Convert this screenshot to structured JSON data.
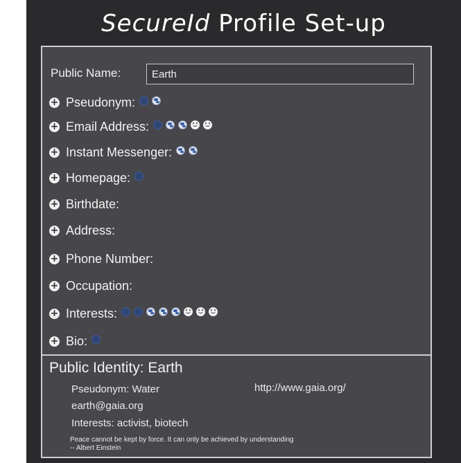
{
  "title": {
    "italic_part": "SecureId",
    "rest": " Profile Set-up"
  },
  "public_name": {
    "label": "Public Name:",
    "value": "Earth"
  },
  "fields": [
    {
      "label": "Pseudonym:",
      "icons": [
        "globe-icon",
        "earth-icon"
      ]
    },
    {
      "label": "Email Address:",
      "icons": [
        "globe-icon",
        "earth-icon",
        "earth-icon",
        "smiley-icon",
        "smiley-icon"
      ]
    },
    {
      "label": "Instant Messenger:",
      "icons": [
        "earth-icon",
        "earth-icon"
      ]
    },
    {
      "label": "Homepage:",
      "icons": [
        "globe-icon"
      ]
    },
    {
      "label": "Birthdate:",
      "icons": []
    },
    {
      "label": "Address:",
      "icons": []
    },
    {
      "label": "Phone Number:",
      "icons": []
    },
    {
      "label": "Occupation:",
      "icons": []
    },
    {
      "label": "Interests:",
      "icons": [
        "globe-icon",
        "globe-icon",
        "earth-icon",
        "earth-icon",
        "earth-icon",
        "smiley-icon",
        "smiley-icon",
        "smiley-icon"
      ]
    },
    {
      "label": "Bio:",
      "icons": [
        "globe-icon"
      ]
    }
  ],
  "public_identity": {
    "title": "Public Identity: Earth",
    "pseudonym": "Pseudonym: Water",
    "homepage": "http://www.gaia.org/",
    "email": "earth@gaia.org",
    "interests": "Interests: activist, biotech",
    "quote": "Peace cannot be kept by force. It can only be achieved by understanding",
    "quote_author": "-- Albert Einstein"
  },
  "colors": {
    "background": "#2a2a2c",
    "panel": "#47474b",
    "border": "#d0d0d2",
    "text": "#f2f2f2"
  }
}
